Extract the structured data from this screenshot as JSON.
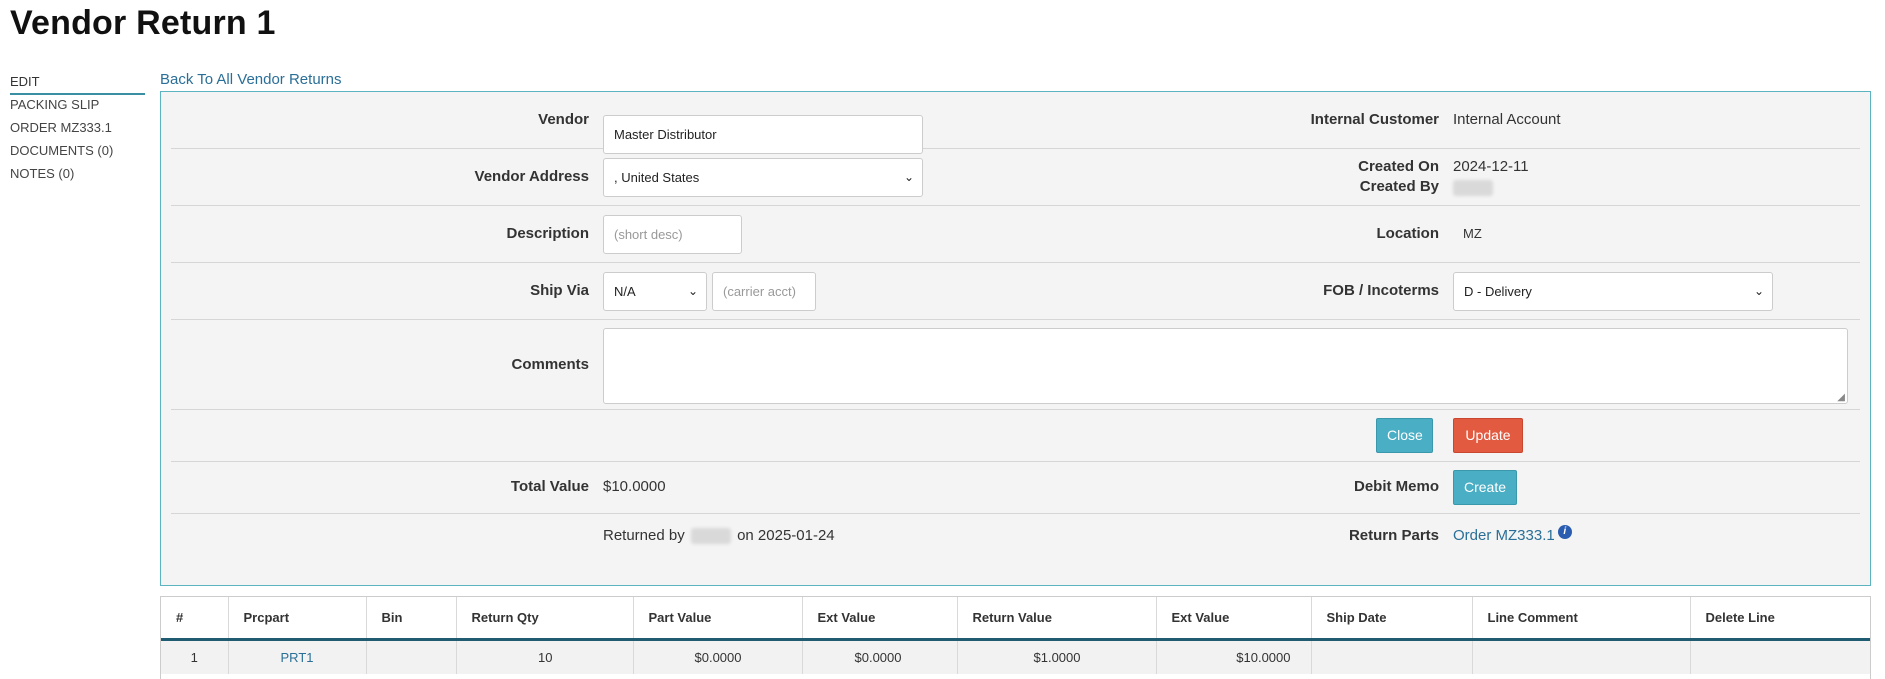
{
  "page": {
    "title": "Vendor Return 1"
  },
  "sidebar": {
    "items": [
      {
        "label": "EDIT"
      },
      {
        "label": "PACKING SLIP"
      },
      {
        "label": "ORDER MZ333.1"
      },
      {
        "label": "DOCUMENTS (0)"
      },
      {
        "label": "NOTES (0)"
      }
    ]
  },
  "back_link": "Back To All Vendor Returns",
  "form": {
    "vendor": {
      "label": "Vendor",
      "value": "Master Distributor"
    },
    "internal_customer": {
      "label": "Internal Customer",
      "value": "Internal Account"
    },
    "vendor_address": {
      "label": "Vendor Address",
      "value": ", United States"
    },
    "created_on": {
      "label": "Created On",
      "value": "2024-12-11"
    },
    "created_by": {
      "label": "Created By"
    },
    "description": {
      "label": "Description",
      "placeholder": "(short desc)"
    },
    "location": {
      "label": "Location",
      "value": "MZ"
    },
    "ship_via": {
      "label": "Ship Via",
      "value": "N/A",
      "carrier_placeholder": "(carrier acct)"
    },
    "fob": {
      "label": "FOB / Incoterms",
      "value": "D - Delivery"
    },
    "comments": {
      "label": "Comments",
      "value": ""
    },
    "close_button": "Close",
    "update_button": "Update",
    "total_value": {
      "label": "Total Value",
      "value": "$10.0000"
    },
    "debit_memo": {
      "label": "Debit Memo",
      "button": "Create"
    },
    "returned": {
      "prefix": "Returned by",
      "suffix": "on 2025-01-24"
    },
    "return_parts": {
      "label": "Return Parts",
      "link": "Order MZ333.1"
    }
  },
  "table": {
    "headers": [
      "#",
      "Prcpart",
      "Bin",
      "Return Qty",
      "Part Value",
      "Ext Value",
      "Return Value",
      "Ext Value",
      "Ship Date",
      "Line Comment",
      "Delete Line"
    ],
    "rows": [
      {
        "num": "1",
        "prcpart": "PRT1",
        "bin": "",
        "return_qty": "10",
        "part_value": "$0.0000",
        "ext_value": "$0.0000",
        "return_value": "$1.0000",
        "ext_value2": "$10.0000",
        "ship_date": "",
        "line_comment": "",
        "delete_line": ""
      }
    ]
  },
  "colors": {
    "accent": "#4aaec5",
    "danger": "#e25a3f",
    "link": "#2a6f97",
    "panel_border": "#5bb4bf"
  },
  "icons": {
    "info": "info-icon",
    "select": "chevron-down-icon"
  }
}
